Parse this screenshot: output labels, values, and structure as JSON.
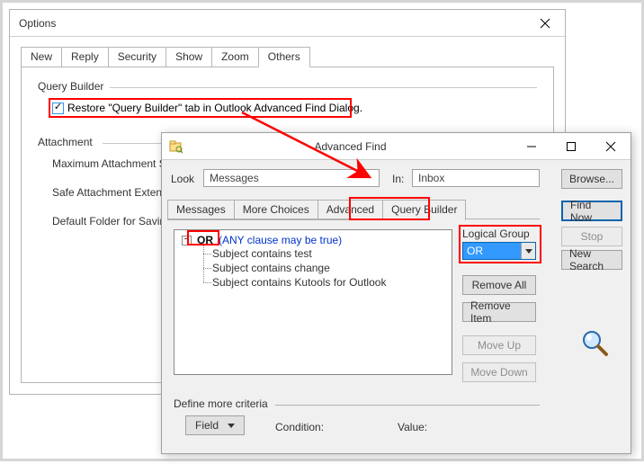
{
  "options": {
    "title": "Options",
    "tabs": [
      "New",
      "Reply",
      "Security",
      "Show",
      "Zoom",
      "Others"
    ],
    "active_tab_index": 5,
    "query_builder": {
      "legend": "Query Builder",
      "checkbox_label": "Restore \"Query Builder\" tab in Outlook Advanced Find Dialog.",
      "checked": true
    },
    "attachment": {
      "legend": "Attachment",
      "rows": [
        "Maximum Attachment Size",
        "Safe Attachment Extension",
        "Default Folder for Saving A"
      ]
    }
  },
  "advfind": {
    "title": "Advanced Find",
    "look_label": "Look",
    "look_value": "Messages",
    "in_label": "In:",
    "in_value": "Inbox",
    "browse_label": "Browse...",
    "tabs": [
      "Messages",
      "More Choices",
      "Advanced",
      "Query Builder"
    ],
    "active_tab_index": 3,
    "tree": {
      "expander": "−",
      "root": "OR",
      "note": "(ANY clause may be true)",
      "children": [
        "Subject contains test",
        "Subject contains change",
        "Subject contains Kutools for Outlook"
      ]
    },
    "logical_group": {
      "label": "Logical Group",
      "value": "OR"
    },
    "buttons": {
      "find_now": "Find Now",
      "stop": "Stop",
      "new_search": "New Search",
      "remove_all": "Remove All",
      "remove_item": "Remove Item",
      "move_up": "Move Up",
      "move_down": "Move Down"
    },
    "define_more": "Define more criteria",
    "field_label": "Field",
    "condition_label": "Condition:",
    "value_label": "Value:"
  }
}
